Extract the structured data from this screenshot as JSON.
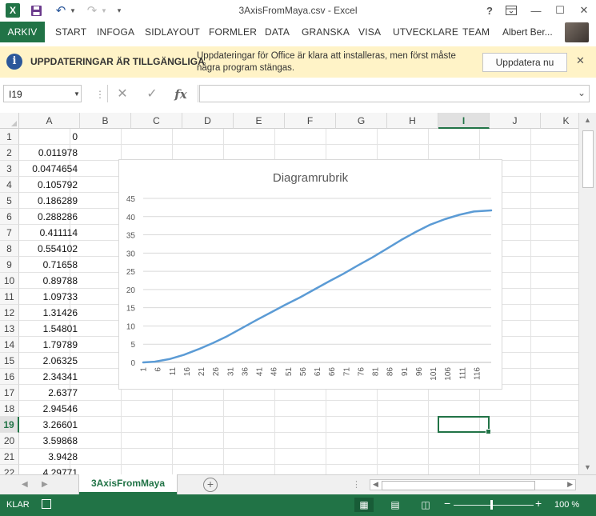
{
  "window": {
    "title": "3AxisFromMaya.csv - Excel",
    "help": "?",
    "minimize": "—",
    "maximize": "☐",
    "close": "✕"
  },
  "ribbon": {
    "tabs": [
      "ARKIV",
      "START",
      "INFOGA",
      "SIDLAYOUT",
      "FORMLER",
      "DATA",
      "GRANSKA",
      "VISA",
      "UTVECKLARE",
      "TEAM"
    ],
    "user": "Albert Ber..."
  },
  "message_bar": {
    "title": "UPPDATERINGAR ÄR TILLGÄNGLIGA",
    "text": "Uppdateringar för Office är klara att installeras, men först måste några program stängas.",
    "button": "Uppdatera nu"
  },
  "formula_bar": {
    "name_box": "I19",
    "fx": "fx",
    "formula": ""
  },
  "grid": {
    "columns": [
      "A",
      "B",
      "C",
      "D",
      "E",
      "F",
      "G",
      "H",
      "I",
      "J",
      "K"
    ],
    "selected_column": "I",
    "selected_row": "19",
    "rows": [
      {
        "row": "1",
        "a": "0"
      },
      {
        "row": "2",
        "a": "0.011978"
      },
      {
        "row": "3",
        "a": "0.0474654"
      },
      {
        "row": "4",
        "a": "0.105792"
      },
      {
        "row": "5",
        "a": "0.186289"
      },
      {
        "row": "6",
        "a": "0.288286"
      },
      {
        "row": "7",
        "a": "0.411114"
      },
      {
        "row": "8",
        "a": "0.554102"
      },
      {
        "row": "9",
        "a": "0.71658"
      },
      {
        "row": "10",
        "a": "0.89788"
      },
      {
        "row": "11",
        "a": "1.09733"
      },
      {
        "row": "12",
        "a": "1.31426"
      },
      {
        "row": "13",
        "a": "1.54801"
      },
      {
        "row": "14",
        "a": "1.79789"
      },
      {
        "row": "15",
        "a": "2.06325"
      },
      {
        "row": "16",
        "a": "2.34341"
      },
      {
        "row": "17",
        "a": "2.6377"
      },
      {
        "row": "18",
        "a": "2.94546"
      },
      {
        "row": "19",
        "a": "3.26601"
      },
      {
        "row": "20",
        "a": "3.59868"
      },
      {
        "row": "21",
        "a": "3.9428"
      },
      {
        "row": "22",
        "a": "4.29771"
      }
    ]
  },
  "chart_data": {
    "type": "line",
    "title": "Diagramrubrik",
    "xlabel": "",
    "ylabel": "",
    "ylim": [
      0,
      45
    ],
    "yticks": [
      0,
      5,
      10,
      15,
      20,
      25,
      30,
      35,
      40,
      45
    ],
    "x_tick_labels": [
      "1",
      "6",
      "11",
      "16",
      "21",
      "26",
      "31",
      "36",
      "41",
      "46",
      "51",
      "56",
      "61",
      "66",
      "71",
      "76",
      "81",
      "86",
      "91",
      "96",
      "101",
      "106",
      "111",
      "116"
    ],
    "x_count": 121,
    "series_color": "#5b9bd5",
    "grid": true,
    "legend": "none",
    "series": [
      {
        "x": [
          1,
          5,
          10,
          15,
          20,
          25,
          30,
          35,
          40,
          45,
          50,
          55,
          60,
          65,
          70,
          75,
          80,
          85,
          90,
          95,
          100,
          105,
          110,
          115,
          121
        ],
        "values": [
          0,
          0.19,
          0.9,
          2.06,
          3.6,
          5.3,
          7.2,
          9.4,
          11.6,
          13.7,
          15.8,
          17.8,
          20.0,
          22.2,
          24.3,
          26.6,
          28.8,
          31.2,
          33.6,
          35.8,
          37.8,
          39.3,
          40.5,
          41.4,
          41.7
        ]
      }
    ]
  },
  "sheet_bar": {
    "sheet_name": "3AxisFromMaya",
    "add": "+",
    "dots": "⋮"
  },
  "status_bar": {
    "status": "KLAR",
    "zoom": "100 %"
  }
}
